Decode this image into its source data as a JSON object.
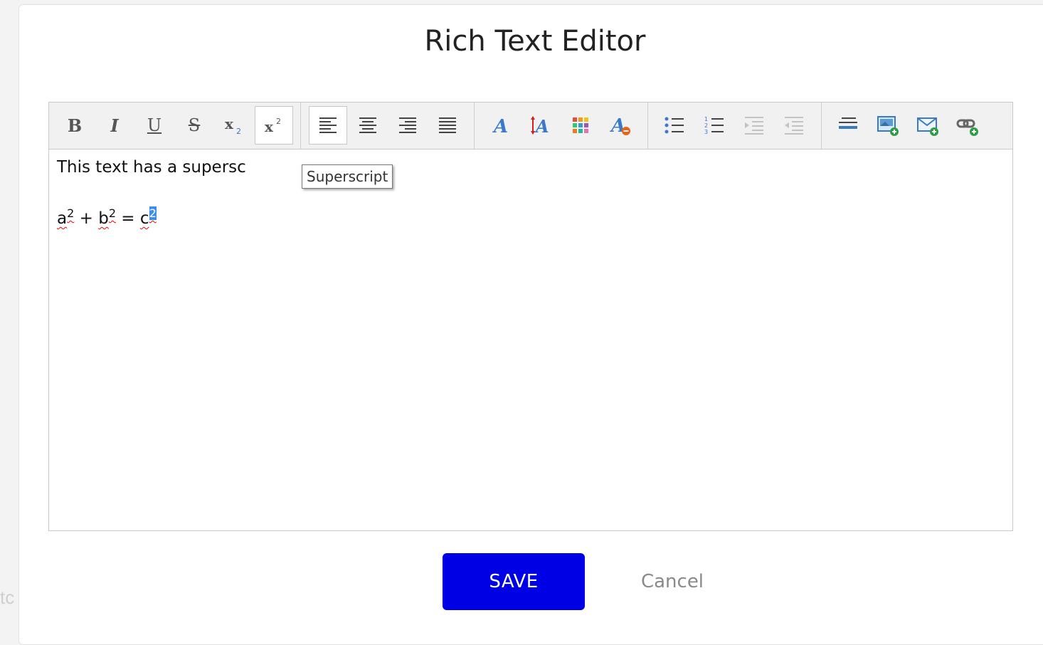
{
  "background_text": "tc",
  "dialog": {
    "title": "Rich Text Editor"
  },
  "toolbar": {
    "groups": [
      [
        "bold",
        "italic",
        "underline",
        "strikethrough",
        "subscript",
        "superscript"
      ],
      [
        "align-left",
        "align-center",
        "align-right",
        "justify"
      ],
      [
        "font-name",
        "font-size",
        "text-color",
        "remove-format"
      ],
      [
        "bulleted-list",
        "numbered-list",
        "indent",
        "outdent"
      ],
      [
        "horizontal-rule",
        "insert-image",
        "insert-email",
        "insert-link"
      ]
    ],
    "active": [
      "superscript",
      "align-left"
    ]
  },
  "tooltip": {
    "text": "Superscript"
  },
  "content": {
    "line1": "This text has a supersc",
    "line2": {
      "a": "a",
      "a_exp": "2",
      "plus": " + ",
      "b": "b",
      "b_exp": "2",
      "equals": " = ",
      "c": "c",
      "c_exp": "2"
    }
  },
  "buttons": {
    "save": "SAVE",
    "cancel": "Cancel"
  },
  "colors": {
    "save_button": "#0000e5",
    "selection": "#3b8cf3",
    "icon_blue": "#3a78c9"
  }
}
